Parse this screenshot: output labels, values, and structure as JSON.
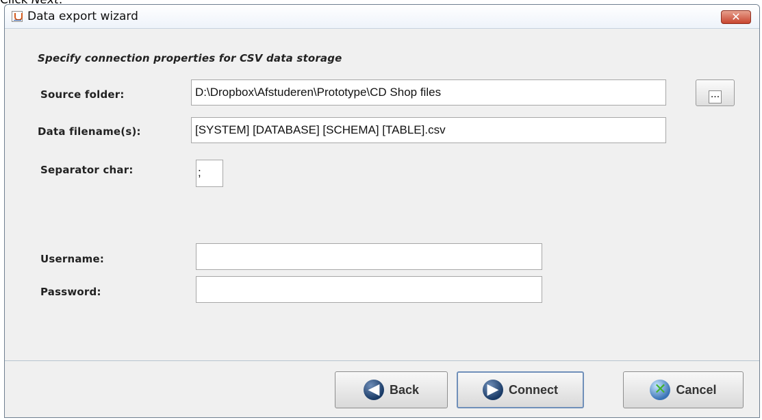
{
  "top_caption": {
    "prefix": "Click ",
    "emphasis": "Next",
    "suffix": "."
  },
  "window": {
    "title": "Data export wizard",
    "close_symbol": "✕",
    "icon": "java-icon"
  },
  "form": {
    "heading": "Specify connection properties for CSV data storage",
    "source_folder_label": "Source folder:",
    "source_folder_value": "D:\\Dropbox\\Afstuderen\\Prototype\\CD Shop files",
    "browse_label": "...",
    "data_filenames_label": "Data filename(s):",
    "data_filenames_value": "[SYSTEM] [DATABASE] [SCHEMA] [TABLE].csv",
    "separator_label": "Separator char:",
    "separator_value": ";",
    "username_label": "Username:",
    "username_value": "",
    "password_label": "Password:",
    "password_value": ""
  },
  "buttons": {
    "back_label": "Back",
    "connect_label": "Connect",
    "cancel_label": "Cancel",
    "back_icon": "arrow-left-icon",
    "connect_icon": "arrow-right-icon",
    "cancel_icon": "cancel-x-icon"
  }
}
